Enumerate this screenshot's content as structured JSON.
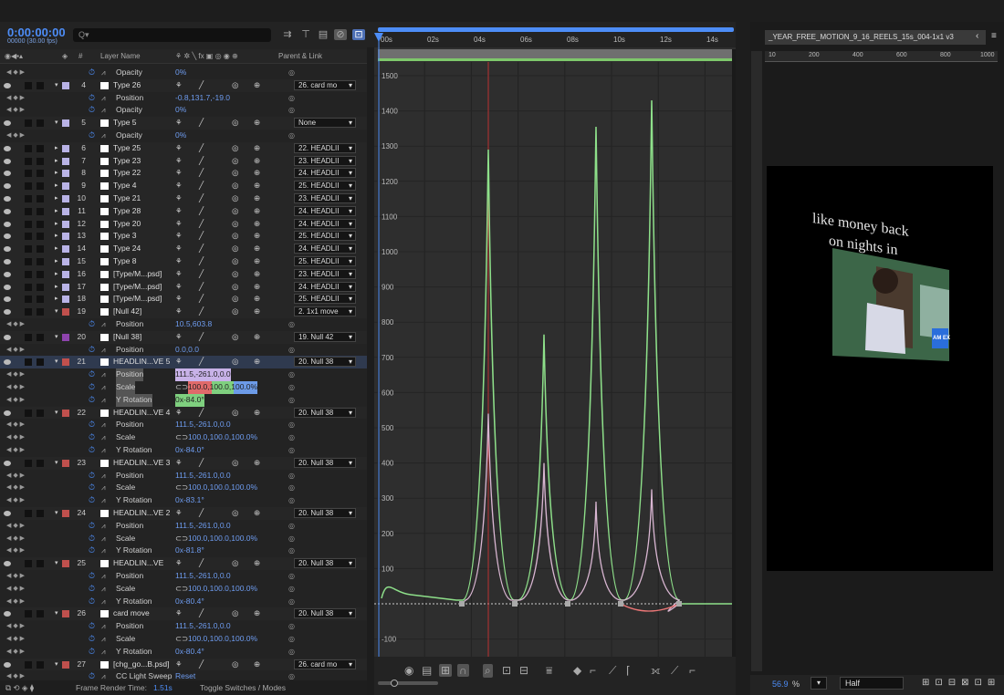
{
  "timecode": "0:00:00:00",
  "fps_label": "00000 (30.00 fps)",
  "search_placeholder": "Q▾",
  "columns": {
    "hash": "#",
    "layer_name": "Layer Name",
    "parent_link": "Parent & Link"
  },
  "rows": [
    {
      "kind": "prop",
      "label": "Opacity",
      "value": "0%"
    },
    {
      "kind": "layer",
      "num": "4",
      "name": "Type 26",
      "color": "#b9b3e6",
      "parent": "26. card mo"
    },
    {
      "kind": "prop",
      "label": "Position",
      "value": "-0.8,131.7,-19.0"
    },
    {
      "kind": "prop",
      "label": "Opacity",
      "value": "0%"
    },
    {
      "kind": "layer",
      "num": "5",
      "name": "Type 5",
      "color": "#b9b3e6",
      "parent": "None"
    },
    {
      "kind": "prop",
      "label": "Opacity",
      "value": "0%"
    },
    {
      "kind": "layer",
      "num": "6",
      "name": "Type 25",
      "color": "#b9b3e6",
      "parent": "22. HEADLII"
    },
    {
      "kind": "layer",
      "num": "7",
      "name": "Type 23",
      "color": "#b9b3e6",
      "parent": "23. HEADLII"
    },
    {
      "kind": "layer",
      "num": "8",
      "name": "Type 22",
      "color": "#b9b3e6",
      "parent": "24. HEADLII"
    },
    {
      "kind": "layer",
      "num": "9",
      "name": "Type 4",
      "color": "#b9b3e6",
      "parent": "25. HEADLII"
    },
    {
      "kind": "layer",
      "num": "10",
      "name": "Type 21",
      "color": "#b9b3e6",
      "parent": "23. HEADLII"
    },
    {
      "kind": "layer",
      "num": "11",
      "name": "Type 28",
      "color": "#b9b3e6",
      "parent": "24. HEADLII"
    },
    {
      "kind": "layer",
      "num": "12",
      "name": "Type 20",
      "color": "#b9b3e6",
      "parent": "24. HEADLII"
    },
    {
      "kind": "layer",
      "num": "13",
      "name": "Type 3",
      "color": "#b9b3e6",
      "parent": "25. HEADLII"
    },
    {
      "kind": "layer",
      "num": "14",
      "name": "Type 24",
      "color": "#b9b3e6",
      "parent": "24. HEADLII"
    },
    {
      "kind": "layer",
      "num": "15",
      "name": "Type 8",
      "color": "#b9b3e6",
      "parent": "25. HEADLII"
    },
    {
      "kind": "layer",
      "num": "16",
      "name": "[Type/M...psd]",
      "color": "#b9b3e6",
      "parent": "23. HEADLII"
    },
    {
      "kind": "layer",
      "num": "17",
      "name": "[Type/M...psd]",
      "color": "#b9b3e6",
      "parent": "24. HEADLII"
    },
    {
      "kind": "layer",
      "num": "18",
      "name": "[Type/M...psd]",
      "color": "#b9b3e6",
      "parent": "25. HEADLII"
    },
    {
      "kind": "layer",
      "num": "19",
      "name": "[Null 42]",
      "color": "#c0504d",
      "parent": "2. 1x1 move"
    },
    {
      "kind": "prop",
      "label": "Position",
      "value": "10.5,603.8"
    },
    {
      "kind": "layer",
      "num": "20",
      "name": "[Null 38]",
      "color": "#8e44ad",
      "parent": "19. Null 42"
    },
    {
      "kind": "prop",
      "label": "Position",
      "value": "0.0,0.0"
    },
    {
      "kind": "layer",
      "num": "21",
      "name": "HEADLIN...VE 5",
      "color": "#c0504d",
      "parent": "20. Null 38",
      "sel": true
    },
    {
      "kind": "prop",
      "label": "Position",
      "value": "111.5,-261.0,0.0",
      "hl": true
    },
    {
      "kind": "prop",
      "label": "Scale",
      "value": "100.0,100.0,100.0%",
      "hl": true,
      "link": true
    },
    {
      "kind": "prop",
      "label": "Y Rotation",
      "value": "0x-84.0°",
      "hl": true
    },
    {
      "kind": "layer",
      "num": "22",
      "name": "HEADLIN...VE 4",
      "color": "#c0504d",
      "parent": "20. Null 38"
    },
    {
      "kind": "prop",
      "label": "Position",
      "value": "111.5,-261.0,0.0"
    },
    {
      "kind": "prop",
      "label": "Scale",
      "value": "100.0,100.0,100.0%",
      "link": true
    },
    {
      "kind": "prop",
      "label": "Y Rotation",
      "value": "0x-84.0°"
    },
    {
      "kind": "layer",
      "num": "23",
      "name": "HEADLIN...VE 3",
      "color": "#c0504d",
      "parent": "20. Null 38"
    },
    {
      "kind": "prop",
      "label": "Position",
      "value": "111.5,-261.0,0.0"
    },
    {
      "kind": "prop",
      "label": "Scale",
      "value": "100.0,100.0,100.0%",
      "link": true
    },
    {
      "kind": "prop",
      "label": "Y Rotation",
      "value": "0x-83.1°"
    },
    {
      "kind": "layer",
      "num": "24",
      "name": "HEADLIN...VE 2",
      "color": "#c0504d",
      "parent": "20. Null 38"
    },
    {
      "kind": "prop",
      "label": "Position",
      "value": "111.5,-261.0,0.0"
    },
    {
      "kind": "prop",
      "label": "Scale",
      "value": "100.0,100.0,100.0%",
      "link": true
    },
    {
      "kind": "prop",
      "label": "Y Rotation",
      "value": "0x-81.8°"
    },
    {
      "kind": "layer",
      "num": "25",
      "name": "HEADLIN...VE",
      "color": "#c0504d",
      "parent": "20. Null 38"
    },
    {
      "kind": "prop",
      "label": "Position",
      "value": "111.5,-261.0,0.0"
    },
    {
      "kind": "prop",
      "label": "Scale",
      "value": "100.0,100.0,100.0%",
      "link": true
    },
    {
      "kind": "prop",
      "label": "Y Rotation",
      "value": "0x-80.4°"
    },
    {
      "kind": "layer",
      "num": "26",
      "name": "card move",
      "color": "#c0504d",
      "parent": "20. Null 38"
    },
    {
      "kind": "prop",
      "label": "Position",
      "value": "111.5,-261.0,0.0"
    },
    {
      "kind": "prop",
      "label": "Scale",
      "value": "100.0,100.0,100.0%",
      "link": true
    },
    {
      "kind": "prop",
      "label": "Y Rotation",
      "value": "0x-80.4°"
    },
    {
      "kind": "layer",
      "num": "27",
      "name": "[chg_go...B.psd]",
      "color": "#c0504d",
      "parent": "26. card mo"
    },
    {
      "kind": "prop",
      "label": "CC Light Sweep",
      "value": "Reset"
    }
  ],
  "status": {
    "frame_render_label": "Frame Render Time:",
    "frame_render_value": "1.51s",
    "toggle_label": "Toggle Switches / Modes"
  },
  "time_ruler": [
    "00s",
    "02s",
    "04s",
    "06s",
    "08s",
    "10s",
    "12s",
    "14s"
  ],
  "graph_values": [
    "1500",
    "1400",
    "1300",
    "1200",
    "1100",
    "1000",
    "900",
    "800",
    "700",
    "600",
    "500",
    "400",
    "300",
    "200",
    "100",
    "-100"
  ],
  "viewer": {
    "tab_title": "_YEAR_FREE_MOTION_9_16_REELS_15s_004-1x1 v3",
    "ruler": [
      "10",
      "200",
      "400",
      "600",
      "800",
      "1000"
    ],
    "text_line1": "like money back",
    "text_line2": "on nights in",
    "card_logo": "AM EX",
    "zoom": "56.9",
    "zoom_unit": "%",
    "resolution": "Half"
  }
}
